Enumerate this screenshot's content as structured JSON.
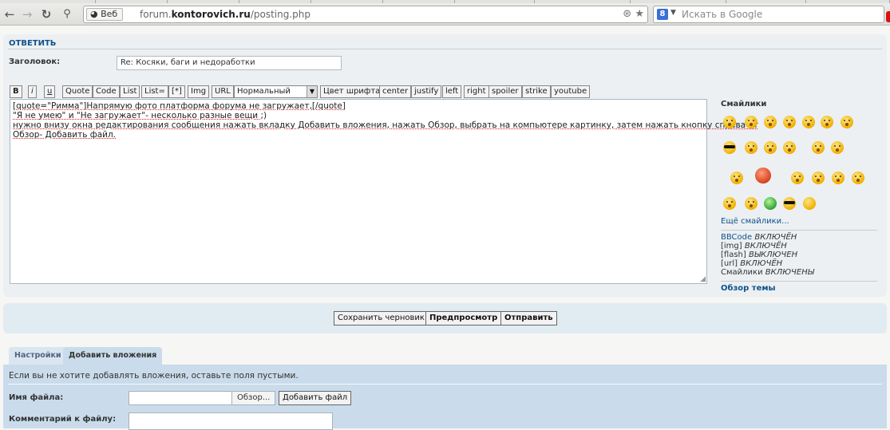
{
  "browser": {
    "identity_label": "Веб",
    "url_host_prefix": "forum.",
    "url_host_bold": "kontorovich.ru",
    "url_path": "/posting.php",
    "search_placeholder": "Искать в Google"
  },
  "post_form": {
    "panel_title": "ОТВЕТИТЬ",
    "subject_label": "Заголовок:",
    "subject_value": "Re: Косяки, баги и недоработки",
    "toolbar": {
      "bold": "B",
      "italic": "i",
      "underline": "u",
      "quote": "Quote",
      "code": "Code",
      "list": "List",
      "list_ordered": "List=",
      "list_item": "[*]",
      "img": "Img",
      "url": "URL",
      "font_size_selected": "Нормальный",
      "font_color": "Цвет шрифта",
      "center": "center",
      "justify": "justify",
      "left": "left",
      "right": "right",
      "spoiler": "spoiler",
      "strike": "strike",
      "youtube": "youtube"
    },
    "message_lines": [
      "[quote=\"Римма\"]Напрямую фото платформа форума не загружает,[/quote]",
      "\"Я не умею\" и \"Не загружает\"- несколько разные вещи ;)",
      "нужно внизу окна редактирования сообщения нажать вкладку Добавить вложения, нажать Обзор, выбрать на компьютере картинку, затем нажать кнопку справа от",
      "Обзор- Добавить файл."
    ]
  },
  "sidebar": {
    "smilies_title": "Смайлики",
    "more_smilies": "Ещё смайлики...",
    "bbcode_link": "BBCode",
    "bbcode_state": "ВКЛЮЧЁН",
    "img_label": "[img]",
    "img_state": "ВКЛЮЧЁН",
    "flash_label": "[flash]",
    "flash_state": "ВЫКЛЮЧЕН",
    "url_label": "[url]",
    "url_state": "ВКЛЮЧЁН",
    "smilies_label": "Смайлики",
    "smilies_state": "ВКЛЮЧЕНЫ",
    "topic_review": "Обзор темы"
  },
  "actions": {
    "save_draft": "Сохранить черновик",
    "preview": "Предпросмотр",
    "submit": "Отправить"
  },
  "attachments": {
    "tab_settings": "Настройки",
    "tab_attach": "Добавить вложения",
    "info": "Если вы не хотите добавлять вложения, оставьте поля пустыми.",
    "filename_label": "Имя файла:",
    "browse": "Обзор...",
    "add_file": "Добавить файл",
    "comment_label": "Комментарий к файлу:"
  }
}
